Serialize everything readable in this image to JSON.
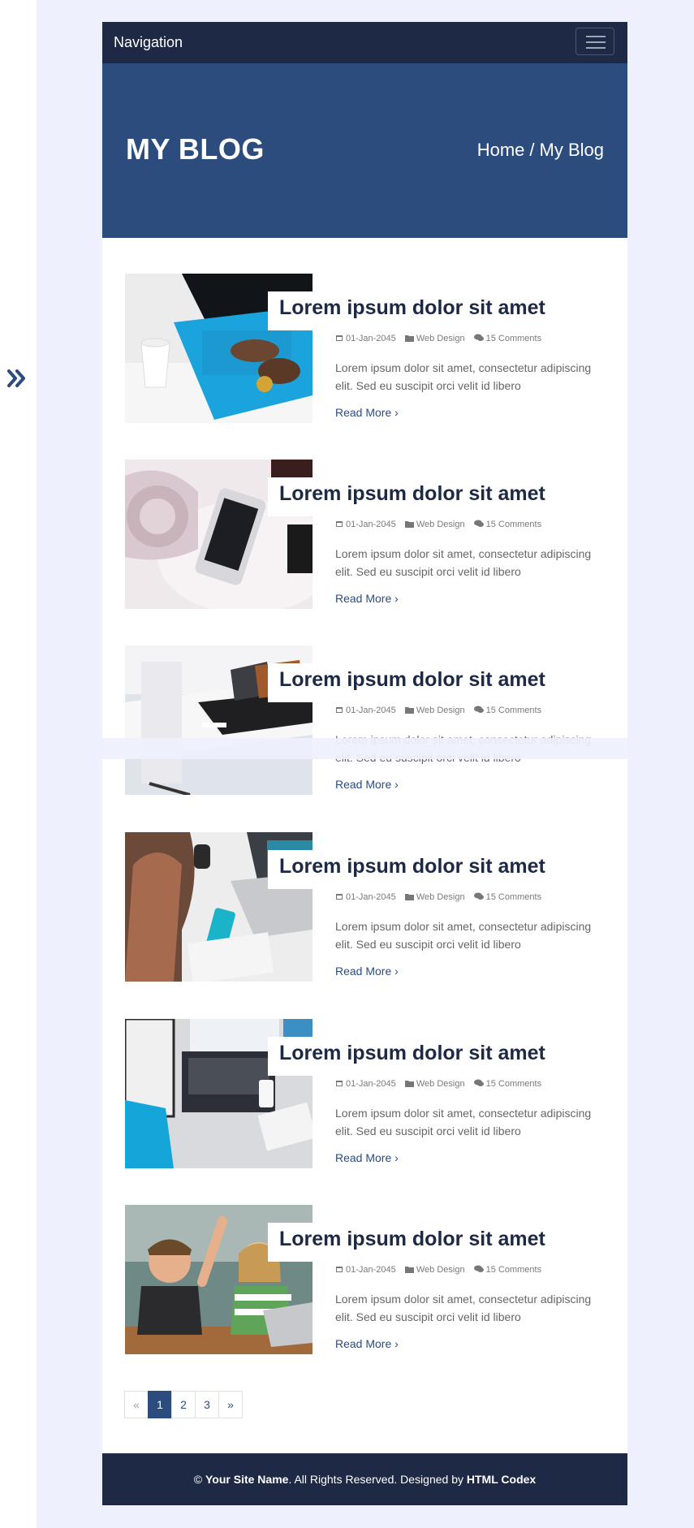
{
  "navbar": {
    "brand": "Navigation",
    "toggler_icon": "hamburger-icon"
  },
  "header": {
    "title": "MY BLOG",
    "breadcrumb": {
      "home": "Home",
      "separator": "/",
      "current": "My Blog"
    }
  },
  "sidebar_toggle": {
    "icon": "double-chevron-right-icon"
  },
  "posts": [
    {
      "title": "Lorem ipsum dolor sit amet",
      "date": "01-Jan-2045",
      "category": "Web Design",
      "comments": "15 Comments",
      "excerpt": "Lorem ipsum dolor sit amet, consectetur adipiscing elit. Sed eu suscipit orci velit id libero",
      "read_more": "Read More"
    },
    {
      "title": "Lorem ipsum dolor sit amet",
      "date": "01-Jan-2045",
      "category": "Web Design",
      "comments": "15 Comments",
      "excerpt": "Lorem ipsum dolor sit amet, consectetur adipiscing elit. Sed eu suscipit orci velit id libero",
      "read_more": "Read More"
    },
    {
      "title": "Lorem ipsum dolor sit amet",
      "date": "01-Jan-2045",
      "category": "Web Design",
      "comments": "15 Comments",
      "excerpt": "Lorem ipsum dolor sit amet, consectetur adipiscing elit. Sed eu suscipit orci velit id libero",
      "read_more": "Read More"
    },
    {
      "title": "Lorem ipsum dolor sit amet",
      "date": "01-Jan-2045",
      "category": "Web Design",
      "comments": "15 Comments",
      "excerpt": "Lorem ipsum dolor sit amet, consectetur adipiscing elit. Sed eu suscipit orci velit id libero",
      "read_more": "Read More"
    },
    {
      "title": "Lorem ipsum dolor sit amet",
      "date": "01-Jan-2045",
      "category": "Web Design",
      "comments": "15 Comments",
      "excerpt": "Lorem ipsum dolor sit amet, consectetur adipiscing elit. Sed eu suscipit orci velit id libero",
      "read_more": "Read More"
    },
    {
      "title": "Lorem ipsum dolor sit amet",
      "date": "01-Jan-2045",
      "category": "Web Design",
      "comments": "15 Comments",
      "excerpt": "Lorem ipsum dolor sit amet, consectetur adipiscing elit. Sed eu suscipit orci velit id libero",
      "read_more": "Read More"
    }
  ],
  "pagination": {
    "prev": "«",
    "pages": [
      "1",
      "2",
      "3"
    ],
    "next": "»",
    "active": "1"
  },
  "footer": {
    "copyright": "©",
    "site_name": "Your Site Name",
    "rights": ". All Rights Reserved. Designed by",
    "designer": "HTML Codex"
  },
  "colors": {
    "navy": "#1e2a45",
    "header_blue": "#2c4c7d",
    "page_bg": "#eef1fd"
  }
}
